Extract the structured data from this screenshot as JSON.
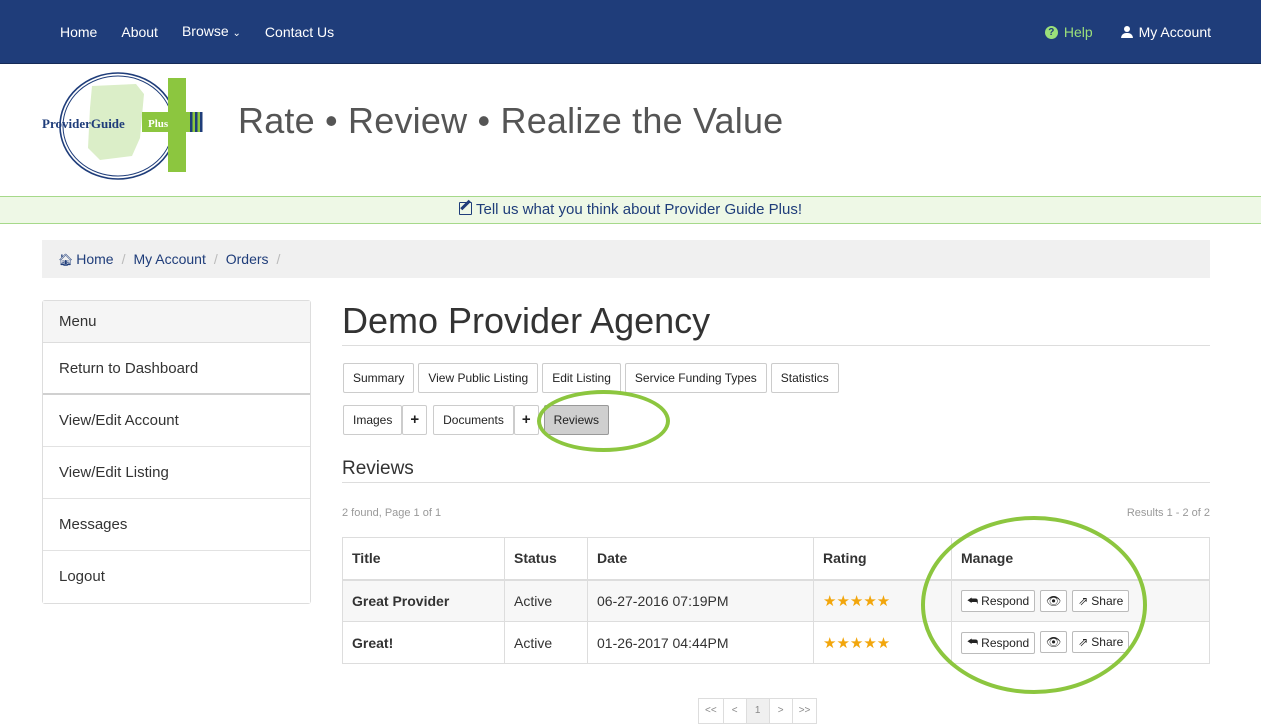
{
  "nav": {
    "home": "Home",
    "about": "About",
    "browse": "Browse",
    "contact": "Contact Us",
    "help": "Help",
    "account": "My Account"
  },
  "header": {
    "logo_main": "ProviderGuide",
    "logo_plus": "Plus",
    "tagline": "Rate • Review • Realize the Value"
  },
  "feedback": {
    "text": "Tell us what you think about Provider Guide Plus!"
  },
  "breadcrumb": {
    "items": [
      "Home",
      "My Account",
      "Orders"
    ]
  },
  "sidebar": {
    "header": "Menu",
    "items": [
      "Return to Dashboard",
      "View/Edit Account",
      "View/Edit Listing",
      "Messages",
      "Logout"
    ]
  },
  "main": {
    "title": "Demo Provider Agency",
    "tabs_row1": [
      "Summary",
      "View Public Listing",
      "Edit Listing",
      "Service Funding Types",
      "Statistics"
    ],
    "tabs_row2": {
      "images": "Images",
      "documents": "Documents",
      "reviews": "Reviews",
      "plus": "+"
    },
    "reviews_heading": "Reviews",
    "found_text": "2 found, Page 1 of 1",
    "results_text": "Results 1 - 2 of 2"
  },
  "table": {
    "headers": [
      "Title",
      "Status",
      "Date",
      "Rating",
      "Manage"
    ],
    "rows": [
      {
        "title": "Great Provider",
        "status": "Active",
        "date": "06-27-2016 07:19PM",
        "stars": "★★★★★",
        "rating": 5
      },
      {
        "title": "Great!",
        "status": "Active",
        "date": "01-26-2017 04:44PM",
        "stars": "★★★★★",
        "rating": 5
      }
    ],
    "respond_label": "Respond",
    "share_label": "Share"
  },
  "pagination": {
    "first": "<<",
    "prev": "<",
    "current": "1",
    "next": ">",
    "last": ">>"
  },
  "colors": {
    "navbar": "#1f3d7a",
    "accent_green": "#8cc63f",
    "star": "#f2a60c"
  }
}
